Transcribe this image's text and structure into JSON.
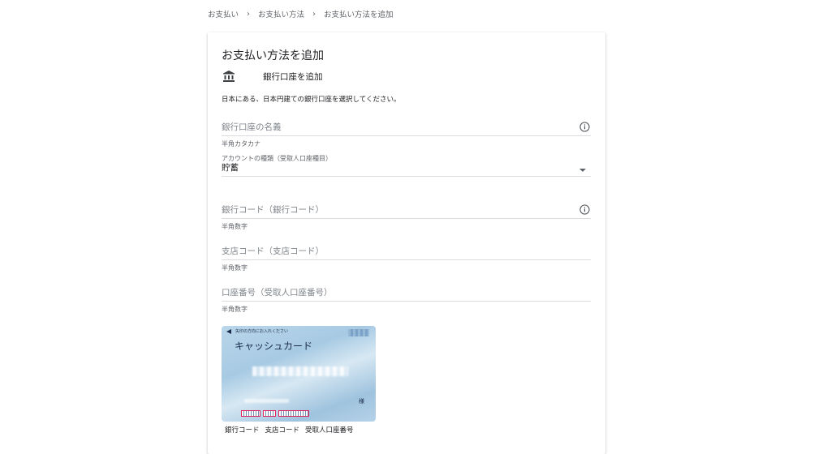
{
  "breadcrumb": {
    "items": [
      "お支払い",
      "お支払い方法",
      "お支払い方法を追加"
    ],
    "separator": "›"
  },
  "card": {
    "title": "お支払い方法を追加",
    "bank_icon": "bank-icon",
    "bank_label": "銀行口座を追加",
    "description": "日本にある、日本円建ての銀行口座を選択してください。"
  },
  "form": {
    "account_name": {
      "placeholder": "銀行口座の名義",
      "hint": "半角カタカナ",
      "icon": "info-icon"
    },
    "account_type": {
      "label": "アカウントの種類（受取人口座種目）",
      "value": "貯蓄",
      "icon": "dropdown-arrow-icon"
    },
    "bank_code": {
      "placeholder": "銀行コード（銀行コード）",
      "hint": "半角数字",
      "icon": "info-icon"
    },
    "branch_code": {
      "placeholder": "支店コード（支店コード）",
      "hint": "半角数字"
    },
    "account_number": {
      "placeholder": "口座番号（受取人口座番号）",
      "hint": "半角数字"
    }
  },
  "card_illustration": {
    "header_text": "矢印の方向にお入れください",
    "card_name": "キャッシュカード",
    "suffix": "様",
    "captions": [
      "銀行コード",
      "支店コード",
      "受取人口座番号"
    ]
  },
  "colors": {
    "divider": "#dadce0",
    "placeholder": "#80868b",
    "highlight": "#e0245e"
  }
}
